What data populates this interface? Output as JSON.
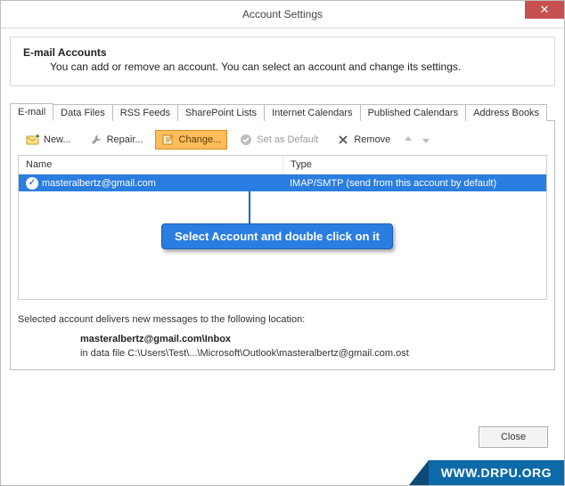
{
  "window": {
    "title": "Account Settings",
    "close_glyph": "✕"
  },
  "header": {
    "title": "E-mail Accounts",
    "subtitle": "You can add or remove an account. You can select an account and change its settings."
  },
  "tabs": [
    {
      "id": "email",
      "label": "E-mail"
    },
    {
      "id": "datafiles",
      "label": "Data Files"
    },
    {
      "id": "rss",
      "label": "RSS Feeds"
    },
    {
      "id": "sharepoint",
      "label": "SharePoint Lists"
    },
    {
      "id": "icals",
      "label": "Internet Calendars"
    },
    {
      "id": "pubcals",
      "label": "Published Calendars"
    },
    {
      "id": "addrbooks",
      "label": "Address Books"
    }
  ],
  "toolbar": {
    "new": "New...",
    "repair": "Repair...",
    "change": "Change...",
    "set_default": "Set as Default",
    "remove": "Remove"
  },
  "list": {
    "columns": {
      "name": "Name",
      "type": "Type"
    },
    "rows": [
      {
        "name": "masteralbertz@gmail.com",
        "type": "IMAP/SMTP (send from this account by default)",
        "selected": true,
        "default": true
      }
    ]
  },
  "callout": "Select Account and double click on it",
  "delivery": {
    "intro": "Selected account delivers new messages to the following location:",
    "dest": "masteralbertz@gmail.com\\Inbox",
    "path": "in data file C:\\Users\\Test\\...\\Microsoft\\Outlook\\masteralbertz@gmail.com.ost"
  },
  "buttons": {
    "close": "Close"
  },
  "watermark": "WWW.DRPU.ORG"
}
